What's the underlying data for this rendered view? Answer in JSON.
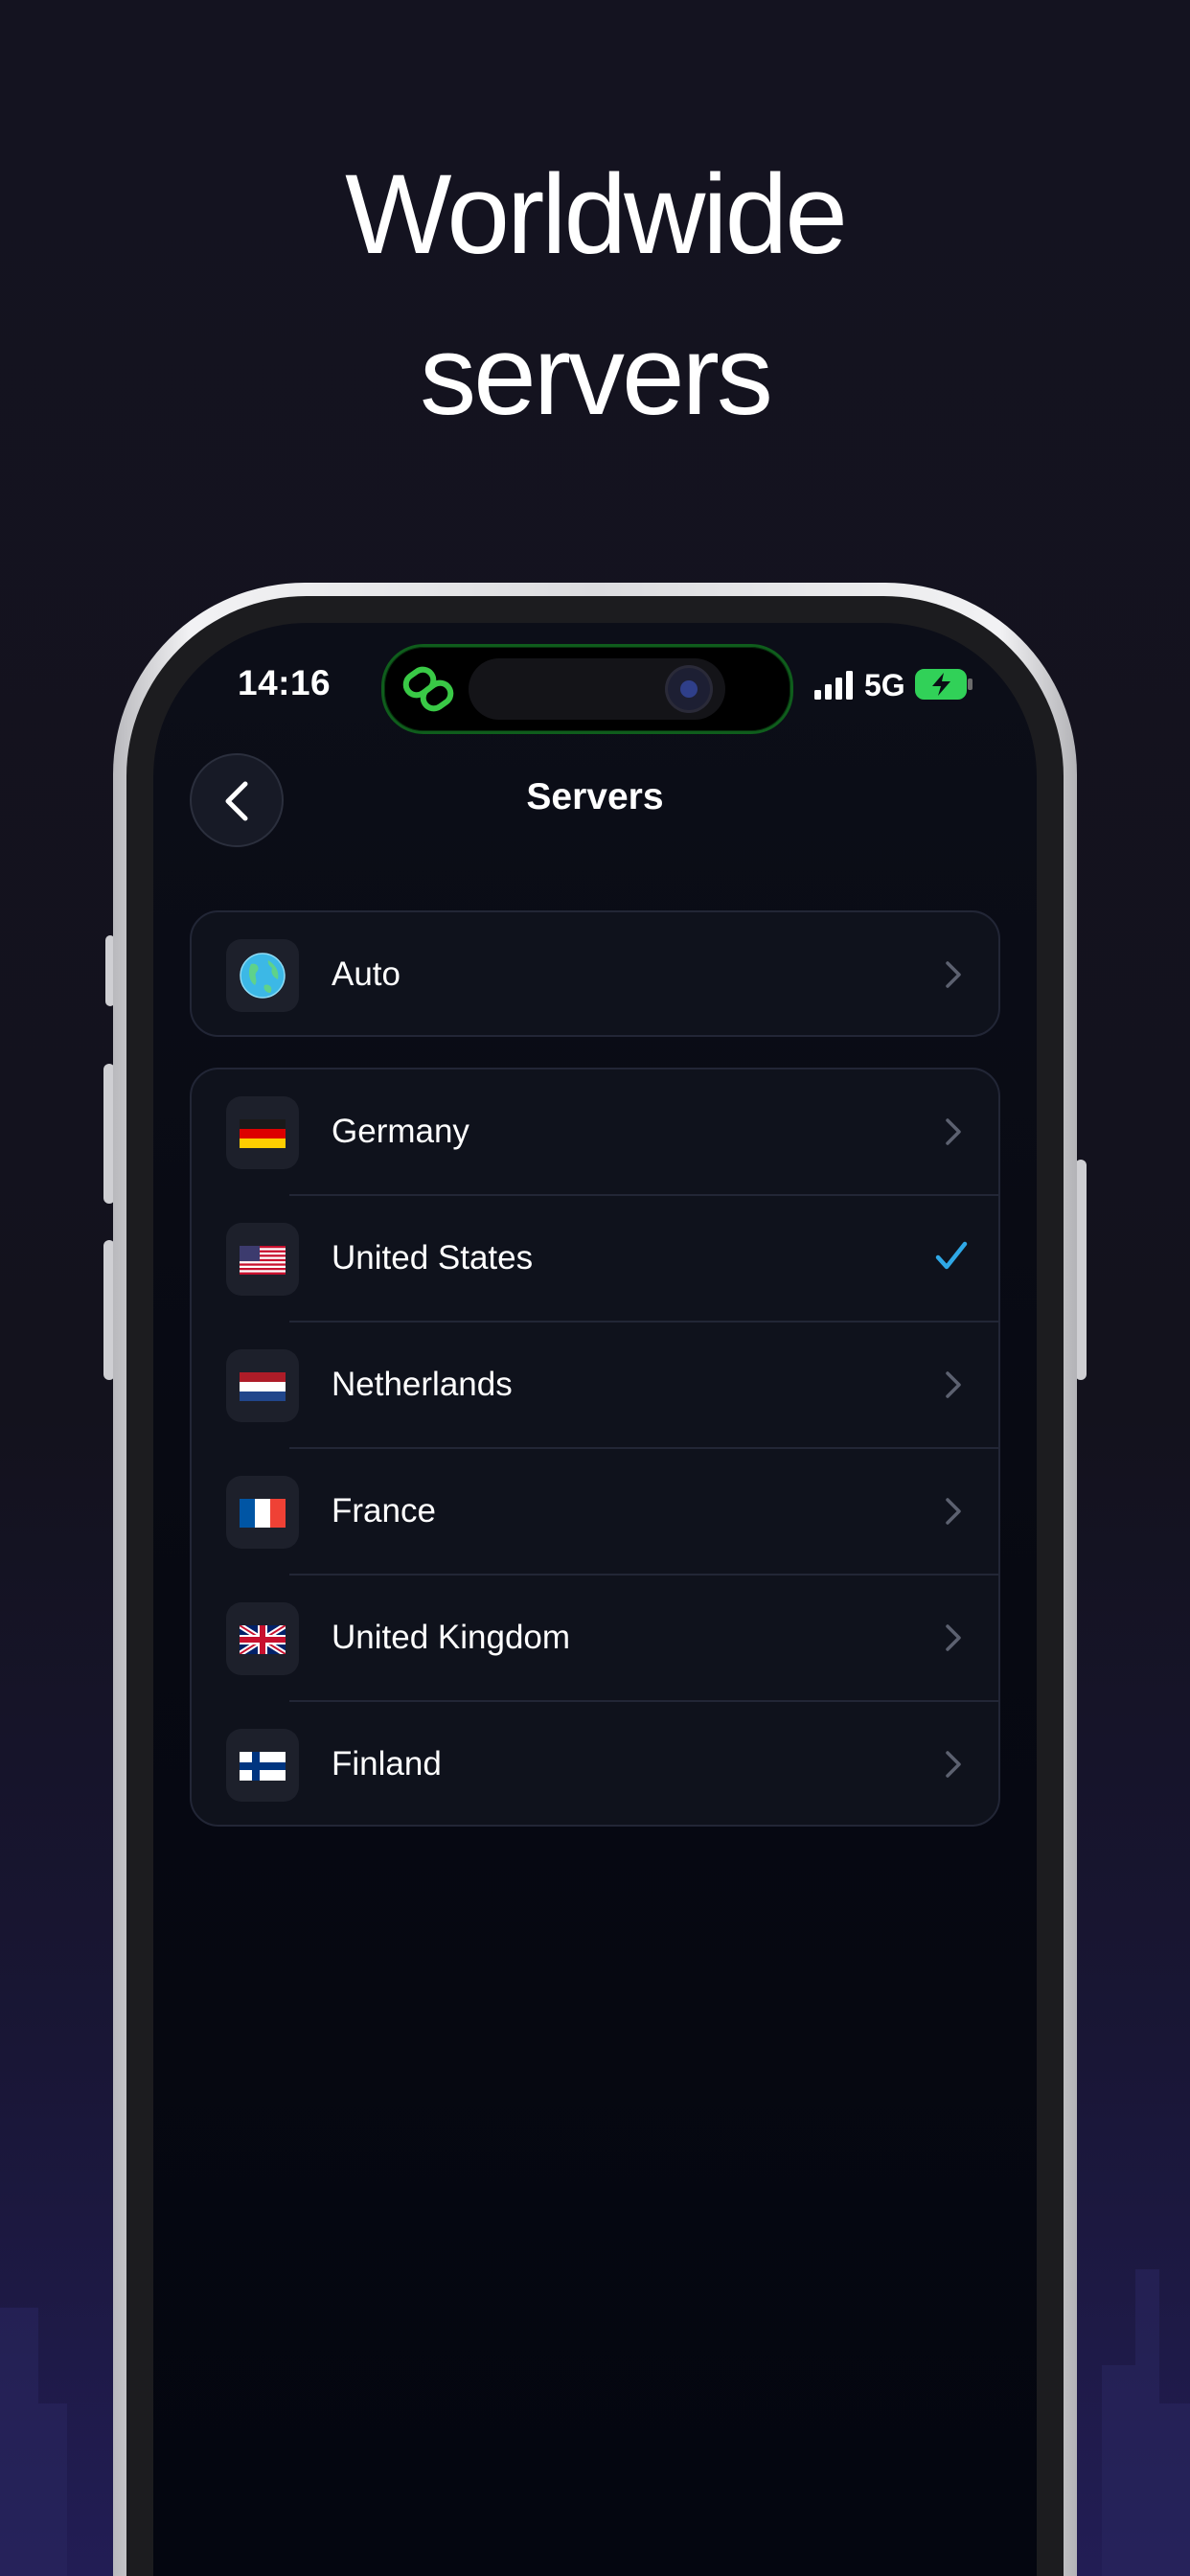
{
  "headline": [
    "Worldwide",
    "servers"
  ],
  "status_bar": {
    "time": "14:16",
    "network": "5G"
  },
  "nav": {
    "title": "Servers"
  },
  "auto_item": {
    "label": "Auto",
    "icon": "globe-icon"
  },
  "servers": [
    {
      "label": "Germany",
      "flag": "germany-flag-icon",
      "selected": false
    },
    {
      "label": "United States",
      "flag": "united-states-flag-icon",
      "selected": true
    },
    {
      "label": "Netherlands",
      "flag": "netherlands-flag-icon",
      "selected": false
    },
    {
      "label": "France",
      "flag": "france-flag-icon",
      "selected": false
    },
    {
      "label": "United Kingdom",
      "flag": "united-kingdom-flag-icon",
      "selected": false
    },
    {
      "label": "Finland",
      "flag": "finland-flag-icon",
      "selected": false
    }
  ],
  "colors": {
    "accent_check": "#2fa8e6",
    "island_link": "#39c946",
    "battery": "#31d158"
  }
}
